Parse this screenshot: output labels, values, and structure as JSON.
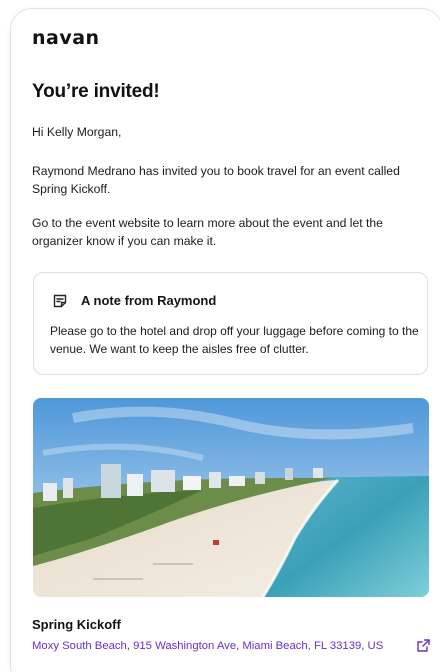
{
  "brand": {
    "logo_text": "navan"
  },
  "email": {
    "title": "You’re invited!",
    "greeting": "Hi Kelly Morgan,",
    "invite_text": "Raymond Medrano has invited you to book travel for an event called Spring Kickoff.",
    "instructions": "Go to the event website to learn more about the event and let the organizer know if you can make it."
  },
  "note": {
    "icon": "note-icon",
    "title": "A note from Raymond",
    "body": "Please go to the hotel and drop off your luggage before coming to the venue. We want to keep the aisles free of clutter."
  },
  "event": {
    "name": "Spring Kickoff",
    "address": "Moxy South Beach, 915 Washington Ave, Miami Beach, FL 33139, US",
    "link_icon": "external-link-icon"
  },
  "colors": {
    "link": "#6a2ecf",
    "text": "#1a1a1a",
    "border": "#dedede"
  }
}
